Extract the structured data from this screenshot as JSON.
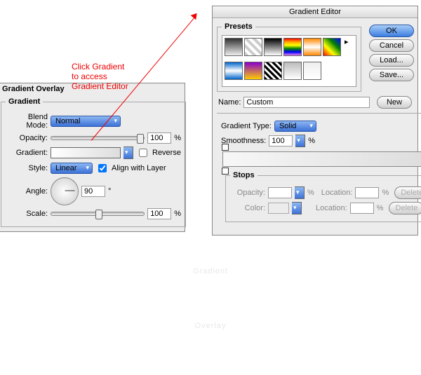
{
  "annotation": "Click Gradient\nto access\nGradient Editor",
  "overlay": {
    "title": "Gradient Overlay",
    "group": "Gradient",
    "blend_mode_label": "Blend Mode:",
    "blend_mode_value": "Normal",
    "opacity_label": "Opacity:",
    "opacity_value": "100",
    "percent": "%",
    "gradient_label": "Gradient:",
    "reverse_label": "Reverse",
    "style_label": "Style:",
    "style_value": "Linear",
    "align_label": "Align with Layer",
    "angle_label": "Angle:",
    "angle_value": "90",
    "degree": "°",
    "scale_label": "Scale:",
    "scale_value": "100"
  },
  "editor": {
    "title": "Gradient Editor",
    "presets_label": "Presets",
    "name_label": "Name:",
    "name_value": "Custom",
    "type_label": "Gradient Type:",
    "type_value": "Solid",
    "smoothness_label": "Smoothness:",
    "smoothness_value": "100",
    "percent": "%",
    "stops_label": "Stops",
    "stop_opacity_label": "Opacity:",
    "stop_color_label": "Color:",
    "location_label": "Location:",
    "delete_label": "Delete",
    "ok": "OK",
    "cancel": "Cancel",
    "load": "Load...",
    "save": "Save...",
    "new": "New"
  },
  "watermark": {
    "line1": "Gradient",
    "line2": "Overlay"
  }
}
